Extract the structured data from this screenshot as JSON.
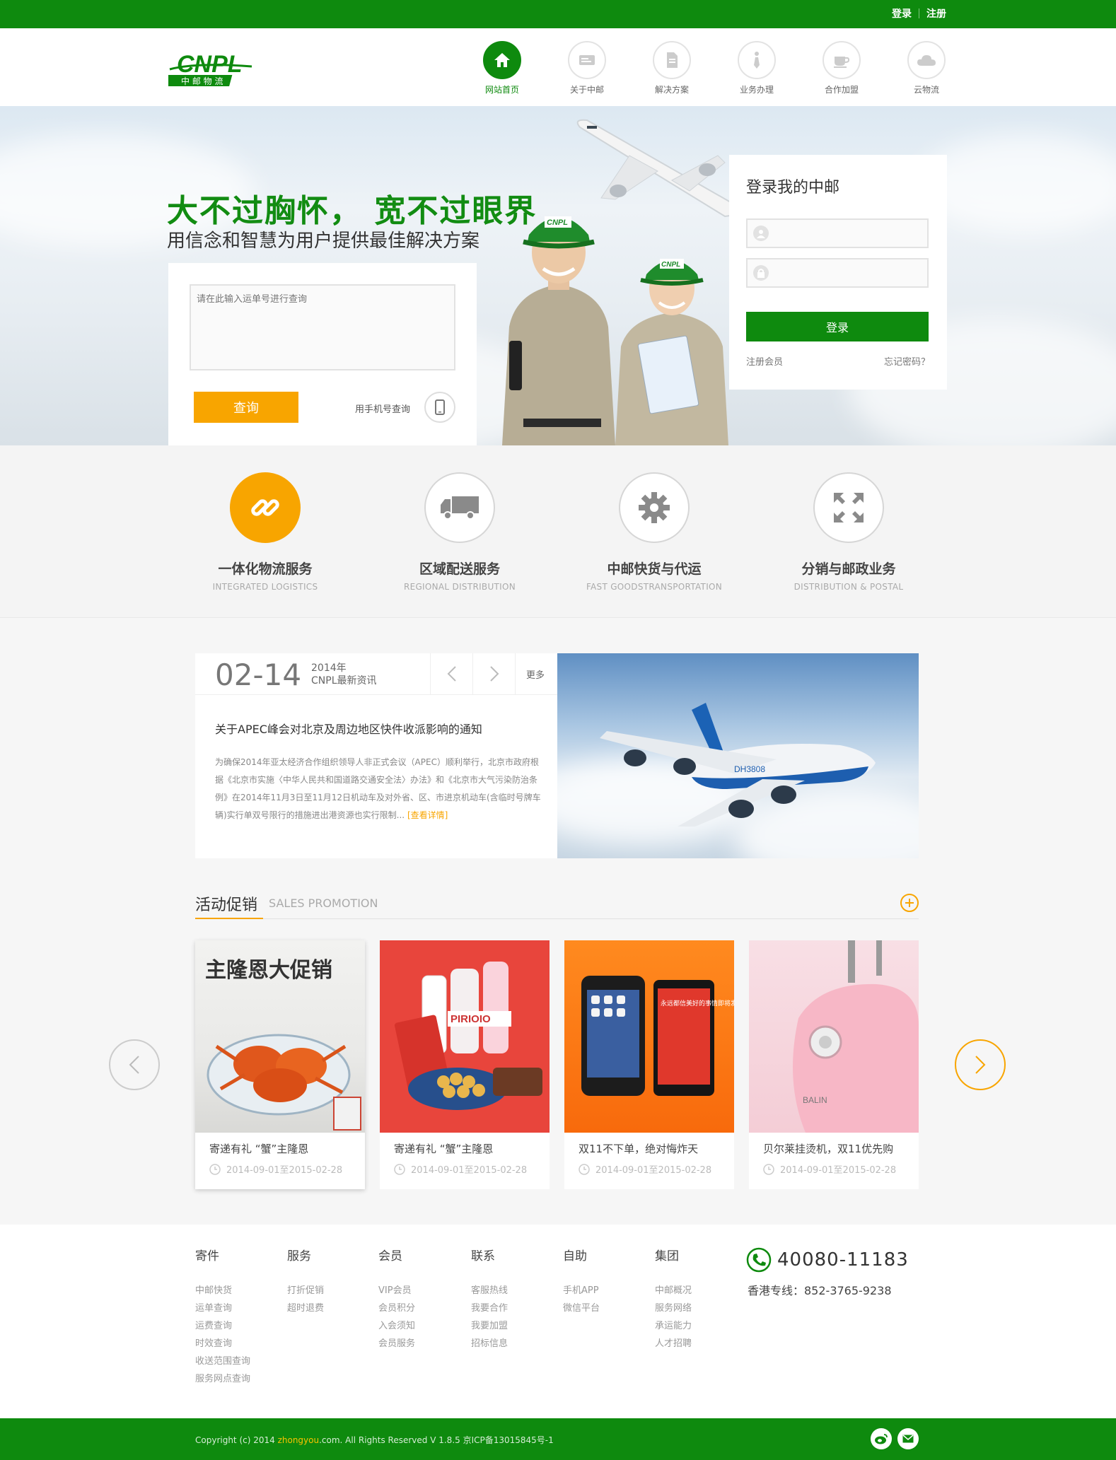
{
  "topbar": {
    "login": "登录",
    "register": "注册"
  },
  "brand": {
    "logo_text": "CNPL",
    "logo_sub": "中 邮 物 流",
    "green": "#0e8a0e",
    "orange": "#f8a500"
  },
  "nav": {
    "items": [
      {
        "label": "网站首页",
        "icon": "home-icon",
        "active": true
      },
      {
        "label": "关于中邮",
        "icon": "card-icon"
      },
      {
        "label": "解决方案",
        "icon": "document-icon"
      },
      {
        "label": "业务办理",
        "icon": "tie-icon"
      },
      {
        "label": "合作加盟",
        "icon": "coffee-icon"
      },
      {
        "label": "云物流",
        "icon": "cloud-icon"
      }
    ]
  },
  "hero": {
    "headline": "大不过胸怀， 宽不过眼界",
    "subheadline": "用信念和智慧为用户提供最佳解决方案",
    "query": {
      "placeholder": "请在此输入运单号进行查询",
      "button": "查询",
      "phone_label": "用手机号查询"
    },
    "cap_badge": "CNPL",
    "login": {
      "title": "登录我的中邮",
      "button": "登录",
      "register_link": "注册会员",
      "forgot_link": "忘记密码？"
    }
  },
  "services": [
    {
      "title": "一体化物流服务",
      "subtitle": "INTEGRATED LOGISTICS",
      "icon": "link-icon",
      "active": true
    },
    {
      "title": "区域配送服务",
      "subtitle": "REGIONAL DISTRIBUTION",
      "icon": "truck-icon"
    },
    {
      "title": "中邮快货与代运",
      "subtitle": "FAST GOODSTRANSPORTATION",
      "icon": "gear-icon"
    },
    {
      "title": "分销与邮政业务",
      "subtitle": "DISTRIBUTION & POSTAL",
      "icon": "expand-icon"
    }
  ],
  "news": {
    "date": "02-14",
    "year": "2014年",
    "category": "CNPL最新资讯",
    "more": "更多",
    "title": "关于APEC峰会对北京及周边地区快件收派影响的通知",
    "body": "为确保2014年亚太经济合作组织领导人非正式会议（APEC）顺利举行，北京市政府根据《北京市实施〈中华人民共和国道路交通安全法〉办法》和《北京市大气污染防治条例》在2014年11月3日至11月12日机动车及对外省、区、市进京机动车(含临时号牌车辆)实行单双号限行的措施进出港资源也实行限制...",
    "detail_link": "[查看详情]",
    "plane_text": "DH3808"
  },
  "promotion": {
    "title": "活动促销",
    "subtitle": "SALES PROMOTION",
    "cards": [
      {
        "title": "寄递有礼 “蟹”主隆恩",
        "date": "2014-09-01至2015-02-28",
        "img_text": "主隆恩大促销",
        "active": true
      },
      {
        "title": "寄递有礼 “蟹”主隆恩",
        "date": "2014-09-01至2015-02-28",
        "img_text": "PIRIOIO"
      },
      {
        "title": "双11不下单，绝对悔炸天",
        "date": "2014-09-01至2015-02-28",
        "img_text": "永远都信美好的事情即将发生"
      },
      {
        "title": "贝尔莱挂烫机，双11优先购",
        "date": "2014-09-01至2015-02-28",
        "img_text": "BALIN"
      }
    ]
  },
  "footer": {
    "columns": [
      {
        "title": "寄件",
        "items": [
          "中邮快货",
          "运单查询",
          "运费查询",
          "时效查询",
          "收送范围查询",
          "服务网点查询"
        ]
      },
      {
        "title": "服务",
        "items": [
          "打折促销",
          "超时退费"
        ]
      },
      {
        "title": "会员",
        "items": [
          "VIP会员",
          "会员积分",
          "入会须知",
          "会员服务"
        ]
      },
      {
        "title": "联系",
        "items": [
          "客服热线",
          "我要合作",
          "我要加盟",
          "招标信息"
        ]
      },
      {
        "title": "自助",
        "items": [
          "手机APP",
          "微信平台"
        ]
      },
      {
        "title": "集团",
        "items": [
          "中邮概况",
          "服务网络",
          "承运能力",
          "人才招聘"
        ]
      }
    ],
    "hotline": "40080-11183",
    "hk_line": "香港专线：852-3765-9238",
    "copyright_pre": "Copyright (c) 2014 ",
    "copyright_brand": "zhongyou",
    "copyright_post": ".com. All Rights Reserved V 1.8.5 京ICP备13015845号-1"
  }
}
